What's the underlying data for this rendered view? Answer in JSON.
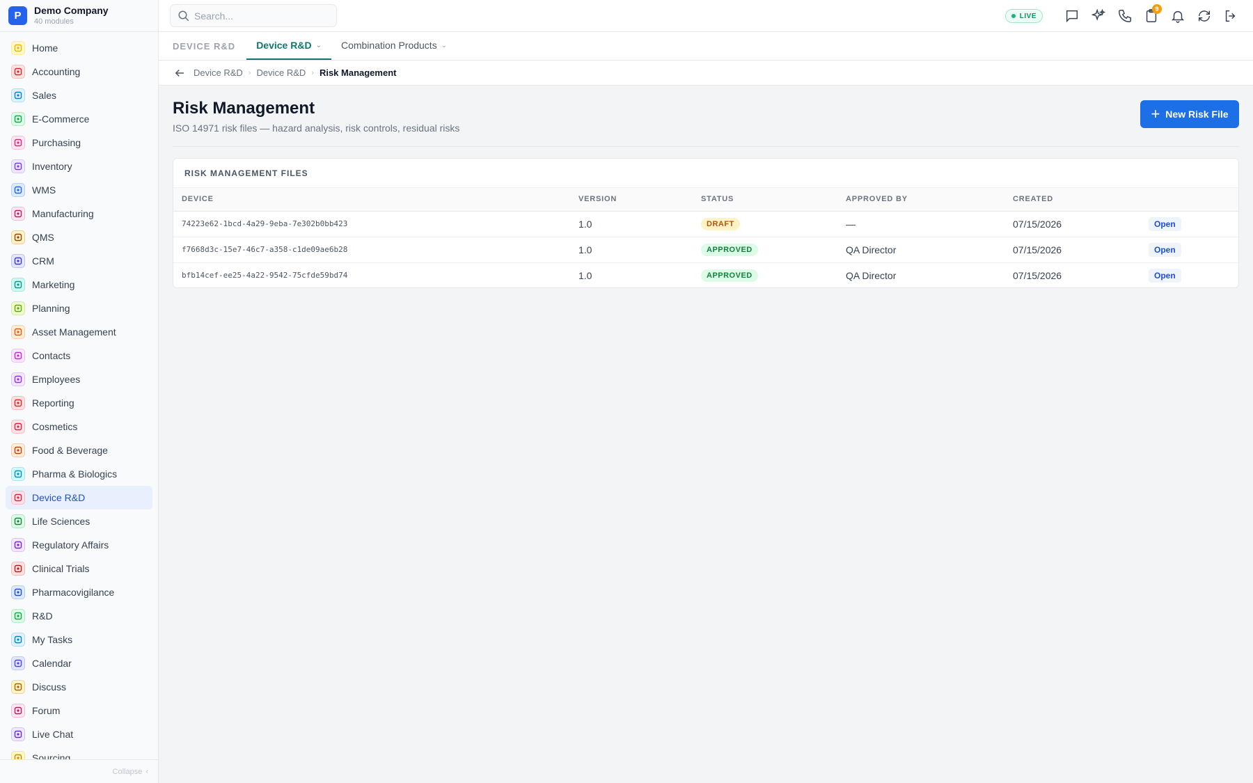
{
  "company": {
    "logo_letter": "P",
    "name": "Demo Company",
    "subtitle": "40 modules"
  },
  "sidebar": {
    "items": [
      {
        "label": "Home",
        "icon": "grid-icon",
        "color": "#eab308",
        "bg": "#fef9c3"
      },
      {
        "label": "Accounting",
        "icon": "bank-icon",
        "color": "#dc2626",
        "bg": "#fee2e2"
      },
      {
        "label": "Sales",
        "icon": "chart-icon",
        "color": "#0284c7",
        "bg": "#e0f2fe"
      },
      {
        "label": "E-Commerce",
        "icon": "store-icon",
        "color": "#16a34a",
        "bg": "#dcfce7"
      },
      {
        "label": "Purchasing",
        "icon": "cart-icon",
        "color": "#db2777",
        "bg": "#fce7f3"
      },
      {
        "label": "Inventory",
        "icon": "box-icon",
        "color": "#7c3aed",
        "bg": "#ede9fe"
      },
      {
        "label": "WMS",
        "icon": "warehouse-icon",
        "color": "#2563eb",
        "bg": "#dbeafe"
      },
      {
        "label": "Manufacturing",
        "icon": "factory-icon",
        "color": "#be185d",
        "bg": "#fce7f3"
      },
      {
        "label": "QMS",
        "icon": "check-circle-icon",
        "color": "#92400e",
        "bg": "#fef3c7"
      },
      {
        "label": "CRM",
        "icon": "users-icon",
        "color": "#4338ca",
        "bg": "#e0e7ff"
      },
      {
        "label": "Marketing",
        "icon": "megaphone-icon",
        "color": "#0d9488",
        "bg": "#ccfbf1"
      },
      {
        "label": "Planning",
        "icon": "calendar-icon",
        "color": "#65a30d",
        "bg": "#ecfccb"
      },
      {
        "label": "Asset Management",
        "icon": "tools-icon",
        "color": "#ea580c",
        "bg": "#ffedd5"
      },
      {
        "label": "Contacts",
        "icon": "contact-icon",
        "color": "#c026d3",
        "bg": "#fae8ff"
      },
      {
        "label": "Employees",
        "icon": "badge-icon",
        "color": "#9333ea",
        "bg": "#f3e8ff"
      },
      {
        "label": "Reporting",
        "icon": "bar-chart-icon",
        "color": "#dc2626",
        "bg": "#fee2e2"
      },
      {
        "label": "Cosmetics",
        "icon": "flower-icon",
        "color": "#e11d48",
        "bg": "#ffe4e6"
      },
      {
        "label": "Food & Beverage",
        "icon": "utensils-icon",
        "color": "#c2410c",
        "bg": "#ffedd5"
      },
      {
        "label": "Pharma & Biologics",
        "icon": "pill-bottle-icon",
        "color": "#0891b2",
        "bg": "#cffafe"
      },
      {
        "label": "Device R&D",
        "icon": "device-icon",
        "color": "#e11d48",
        "bg": "#ffe4e6",
        "active": true
      },
      {
        "label": "Life Sciences",
        "icon": "microscope-icon",
        "color": "#15803d",
        "bg": "#dcfce7"
      },
      {
        "label": "Regulatory Affairs",
        "icon": "gavel-icon",
        "color": "#7e22ce",
        "bg": "#f3e8ff"
      },
      {
        "label": "Clinical Trials",
        "icon": "clipboard-icon",
        "color": "#b91c1c",
        "bg": "#fee2e2"
      },
      {
        "label": "Pharmacovigilance",
        "icon": "shield-icon",
        "color": "#1d4ed8",
        "bg": "#dbeafe"
      },
      {
        "label": "R&D",
        "icon": "flask-icon",
        "color": "#16a34a",
        "bg": "#dcfce7"
      },
      {
        "label": "My Tasks",
        "icon": "checklist-icon",
        "color": "#0284c7",
        "bg": "#e0f2fe"
      },
      {
        "label": "Calendar",
        "icon": "calendar-icon",
        "color": "#4f46e5",
        "bg": "#e0e7ff"
      },
      {
        "label": "Discuss",
        "icon": "chat-icon",
        "color": "#a16207",
        "bg": "#fef3c7"
      },
      {
        "label": "Forum",
        "icon": "forum-icon",
        "color": "#be185d",
        "bg": "#fce7f3"
      },
      {
        "label": "Live Chat",
        "icon": "headset-icon",
        "color": "#6d28d9",
        "bg": "#ede9fe"
      },
      {
        "label": "Sourcing",
        "icon": "target-icon",
        "color": "#ca8a04",
        "bg": "#fef9c3"
      }
    ],
    "collapse_label": "Collapse"
  },
  "topbar": {
    "search_placeholder": "Search...",
    "live_label": "LIVE",
    "notification_count": "9"
  },
  "tabs": {
    "section_label": "DEVICE R&D",
    "items": [
      {
        "label": "Device R&D",
        "active": true
      },
      {
        "label": "Combination Products",
        "active": false
      }
    ]
  },
  "breadcrumb": [
    "Device R&D",
    "Device R&D",
    "Risk Management"
  ],
  "page": {
    "title": "Risk Management",
    "subtitle": "ISO 14971 risk files — hazard analysis, risk controls, residual risks",
    "new_button": "New Risk File"
  },
  "table": {
    "title": "RISK MANAGEMENT FILES",
    "columns": [
      "DEVICE",
      "VERSION",
      "STATUS",
      "APPROVED BY",
      "CREATED",
      ""
    ],
    "rows": [
      {
        "device": "74223e62-1bcd-4a29-9eba-7e302b0bb423",
        "version": "1.0",
        "status": "DRAFT",
        "approved_by": "—",
        "created": "07/15/2026",
        "action": "Open"
      },
      {
        "device": "f7668d3c-15e7-46c7-a358-c1de09ae6b28",
        "version": "1.0",
        "status": "APPROVED",
        "approved_by": "QA Director",
        "created": "07/15/2026",
        "action": "Open"
      },
      {
        "device": "bfb14cef-ee25-4a22-9542-75cfde59bd74",
        "version": "1.0",
        "status": "APPROVED",
        "approved_by": "QA Director",
        "created": "07/15/2026",
        "action": "Open"
      }
    ]
  },
  "colors": {
    "accent": "#1d6fe8",
    "tab_active": "#0f766e",
    "sidebar_active_bg": "#e8f0fd"
  }
}
